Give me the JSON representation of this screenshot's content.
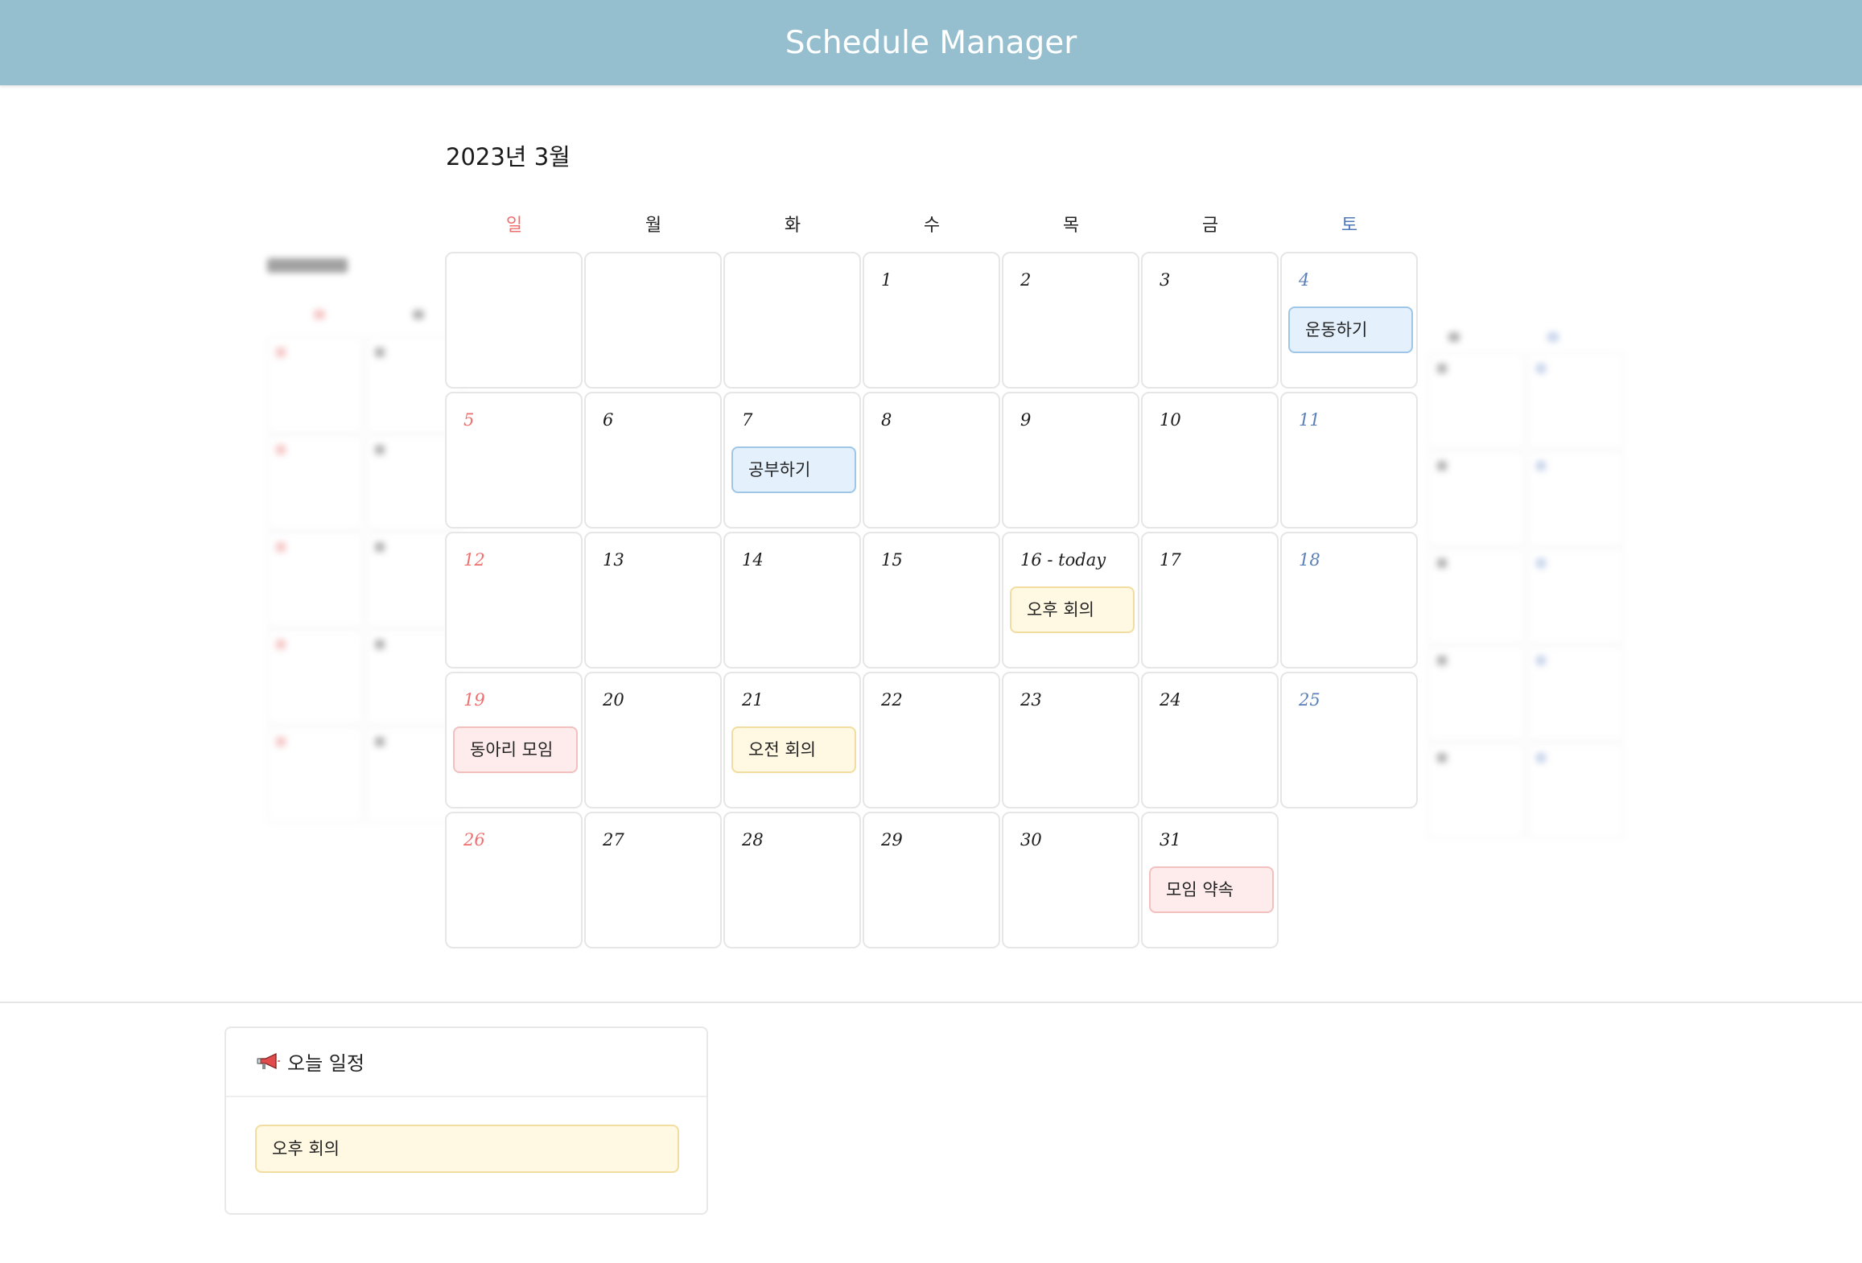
{
  "app": {
    "title": "Schedule Manager"
  },
  "calendar": {
    "month_title": "2023년 3월",
    "weekdays": [
      "일",
      "월",
      "화",
      "수",
      "목",
      "금",
      "토"
    ],
    "weeks": [
      [
        {
          "day": "",
          "events": []
        },
        {
          "day": "",
          "events": []
        },
        {
          "day": "",
          "events": []
        },
        {
          "day": "1",
          "events": []
        },
        {
          "day": "2",
          "events": []
        },
        {
          "day": "3",
          "events": []
        },
        {
          "day": "4",
          "events": [
            {
              "title": "운동하기",
              "color": "blue"
            }
          ]
        }
      ],
      [
        {
          "day": "5",
          "events": []
        },
        {
          "day": "6",
          "events": []
        },
        {
          "day": "7",
          "events": [
            {
              "title": "공부하기",
              "color": "blue"
            }
          ]
        },
        {
          "day": "8",
          "events": []
        },
        {
          "day": "9",
          "events": []
        },
        {
          "day": "10",
          "events": []
        },
        {
          "day": "11",
          "events": []
        }
      ],
      [
        {
          "day": "12",
          "events": []
        },
        {
          "day": "13",
          "events": []
        },
        {
          "day": "14",
          "events": []
        },
        {
          "day": "15",
          "events": []
        },
        {
          "day": "16 - today",
          "events": [
            {
              "title": "오후 회의",
              "color": "yellow"
            }
          ]
        },
        {
          "day": "17",
          "events": []
        },
        {
          "day": "18",
          "events": []
        }
      ],
      [
        {
          "day": "19",
          "events": [
            {
              "title": "동아리 모임",
              "color": "pink"
            }
          ]
        },
        {
          "day": "20",
          "events": []
        },
        {
          "day": "21",
          "events": [
            {
              "title": "오전 회의",
              "color": "yellow"
            }
          ]
        },
        {
          "day": "22",
          "events": []
        },
        {
          "day": "23",
          "events": []
        },
        {
          "day": "24",
          "events": []
        },
        {
          "day": "25",
          "events": []
        }
      ],
      [
        {
          "day": "26",
          "events": []
        },
        {
          "day": "27",
          "events": []
        },
        {
          "day": "28",
          "events": []
        },
        {
          "day": "29",
          "events": []
        },
        {
          "day": "30",
          "events": []
        },
        {
          "day": "31",
          "events": [
            {
              "title": "모임 약속",
              "color": "pink"
            }
          ]
        }
      ]
    ]
  },
  "today_panel": {
    "icon": "megaphone-icon",
    "title": "오늘 일정",
    "items": [
      "오후 회의"
    ]
  },
  "colors": {
    "header": "#95bfcf",
    "sunday": "#ef6f6f",
    "saturday": "#5a7fb8",
    "event_blue_bg": "#e4f1fc",
    "event_yellow_bg": "#fff8e2",
    "event_pink_bg": "#fdeceb"
  }
}
